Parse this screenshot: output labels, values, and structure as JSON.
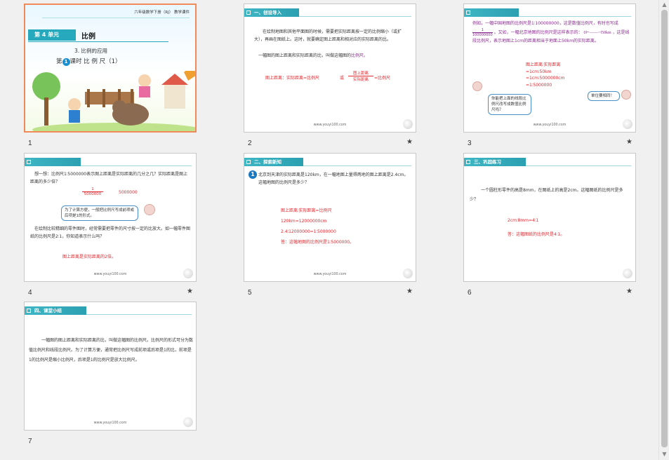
{
  "scrollbar": {
    "up": "▲",
    "down": "▼"
  },
  "slides": [
    {
      "num": "1",
      "grade": "六年级数学下册（RJ）  教学课件",
      "unit": "第 4 单元",
      "unit_name": "比例",
      "sub": "3. 比例的应用",
      "lesson_pre": "第",
      "lesson_num": "1",
      "lesson_post": "课时  比 例 尺（1）"
    },
    {
      "num": "2",
      "header": "一、创设导入",
      "p1": "在绘制地图和其他平面图的时候，需要把实际距离按一定的比例缩小（或扩大），再画在图纸上。这时，就要确定图上距离和相对应的实际距离的比。",
      "p2a": "一幅图的图上距离和实际距离的比，叫做这幅图的",
      "p2b": "比例尺。",
      "f1": "图上距离：实际距离=比例尺",
      "f_or": "或",
      "f_num": "图上距离",
      "f_den": "实际距离",
      "f_eq": "=比例尺",
      "footer": "www.youyi100.com",
      "star": "★"
    },
    {
      "num": "3",
      "p1": "例如，一幅中国地图的比例尺是1∶100000000，这是数值比例尺，有时也写成",
      "p1_num": "1",
      "p1_den": "100000000",
      "p1b": "。又如，一幅北京地图的比例尺是这样表示的：",
      "scale0": "0",
      "scale50": "50km",
      "p1c": "，这是线段比例尺，表示地图上1cm的距离相当于地面上50km的实际距离。",
      "calc": [
        "图上距离∶实际距离",
        "=1cm∶50km",
        "=1cm∶5000000cm",
        "=1∶5000000"
      ],
      "bubble1": "你能把上面的线段比例尺改写成数值比例尺吗？",
      "bubble2": "单位要相同！",
      "footer": "www.youyi100.com",
      "star": "★"
    },
    {
      "num": "4",
      "p1": "想一想：比例尺1∶5000000表示图上距离是实际距离的几分之几？实际距离是图上距离的多少倍？",
      "frac_num": "1",
      "frac_den": "5000000",
      "times": "5000000",
      "bubble": "为了计算方便，一般把比例尺写成前项或后项是1的形式。",
      "p2": "在绘制比较精细的零件图时，经常需要把零件的尺寸按一定的比放大。如一幅零件图纸的比例尺是2∶1，你知道表示什么吗？",
      "ans": "图上距离是实际距离的2倍。",
      "footer": "www.youyi100.com",
      "star": "★"
    },
    {
      "num": "5",
      "header": "二、探索新知",
      "ex_num": "1",
      "p1": "北京到天津的实际距离是120km，在一幅地图上量得两地的图上距离是2.4cm。这幅地图的比例尺是多少？",
      "lines": [
        "图上距离∶实际距离=比例尺",
        "120km=12000000cm",
        "2.4∶12000000=1∶5000000",
        "答：这幅地图的比例尺是1∶5000000。"
      ],
      "footer": "www.youyi100.com",
      "star": "★"
    },
    {
      "num": "6",
      "header": "三、巩固练习",
      "p1": "一个圆柱形零件的高是8mm，在图纸上的高是2cm。这幅图纸的比例尺是多少？",
      "lines": [
        "2cm∶8mm=4∶1",
        "答：这幅图纸的比例尺是4∶1。"
      ],
      "footer": "www.youyi100.com",
      "star": "★"
    },
    {
      "num": "7",
      "header": "四、课堂小结",
      "p1": "一幅图的图上距离和实际距离的比，叫做这幅图的比例尺。比例尺的形式可分为数值比例尺和线段比例尺。为了计算方便，通常把比例尺写成前项或后项是1的比，前项是1的比例尺是缩小比例尺，后项是1的比例尺是放大比例尺。",
      "footer": "www.youyi100.com"
    }
  ]
}
